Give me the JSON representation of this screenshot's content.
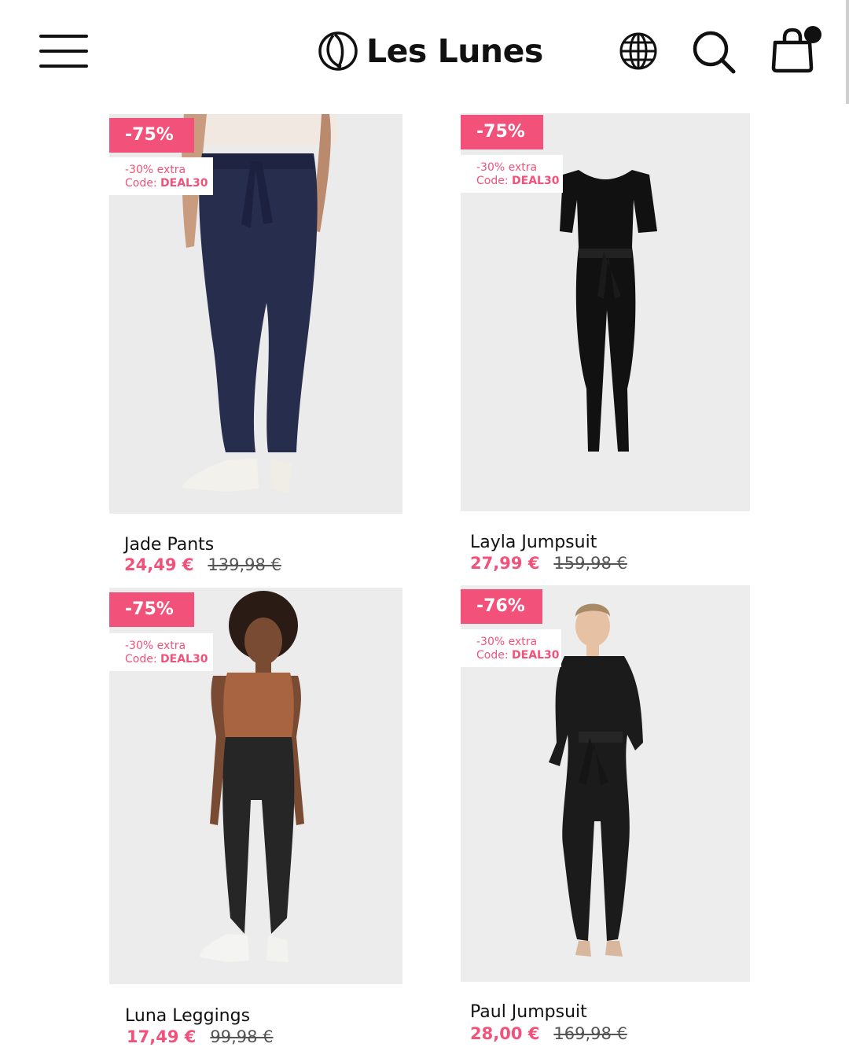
{
  "brand": {
    "name": "Les Lunes"
  },
  "header": {
    "menu_icon": "hamburger-menu-icon",
    "language_icon": "globe-icon",
    "search_icon": "search-icon",
    "cart_icon": "shopping-bag-icon",
    "cart_has_items": true
  },
  "colors": {
    "accent": "#f2527a",
    "text": "#111111",
    "image_bg": "#ececec"
  },
  "products": [
    {
      "name": "Jade Pants",
      "discount": "-75%",
      "extra": "-30% extra",
      "code_label": "Code:",
      "code": "DEAL30",
      "sale_price": "24,49 €",
      "original_price": "139,98 €"
    },
    {
      "name": "Layla Jumpsuit",
      "discount": "-75%",
      "extra": "-30% extra",
      "code_label": "Code:",
      "code": "DEAL30",
      "sale_price": "27,99 €",
      "original_price": "159,98 €"
    },
    {
      "name": "Luna Leggings",
      "discount": "-75%",
      "extra": "-30% extra",
      "code_label": "Code:",
      "code": "DEAL30",
      "sale_price": "17,49 €",
      "original_price": "99,98 €"
    },
    {
      "name": "Paul Jumpsuit",
      "discount": "-76%",
      "extra": "-30% extra",
      "code_label": "Code:",
      "code": "DEAL30",
      "sale_price": "28,00 €",
      "original_price": "169,98 €"
    }
  ]
}
